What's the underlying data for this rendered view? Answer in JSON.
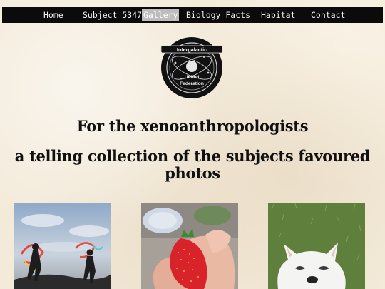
{
  "nav": {
    "items": [
      {
        "label": "Home",
        "active": false
      },
      {
        "label": "Subject 5347",
        "active": false
      },
      {
        "label": "Gallery",
        "active": true
      },
      {
        "label": "Biology Facts",
        "active": false
      },
      {
        "label": "Habitat",
        "active": false
      },
      {
        "label": "Contact",
        "active": false
      }
    ]
  },
  "logo": {
    "line1": "Intergalactic",
    "line2": "United",
    "line3": "Federation"
  },
  "headings": {
    "title": "For the xenoanthropologists",
    "subtitle_line1": "a telling collection of the subjects favoured",
    "subtitle_line2": "photos"
  },
  "gallery": {
    "photos": [
      {
        "subject": "silhouettes-with-ribbons"
      },
      {
        "subject": "strawberry-in-hand"
      },
      {
        "subject": "white-dog-on-grass"
      }
    ]
  },
  "colors": {
    "nav_bg": "#0b0b0b",
    "nav_active_bg": "#bdbdbd",
    "page_bg": "#f3ead9",
    "text": "#111111"
  }
}
